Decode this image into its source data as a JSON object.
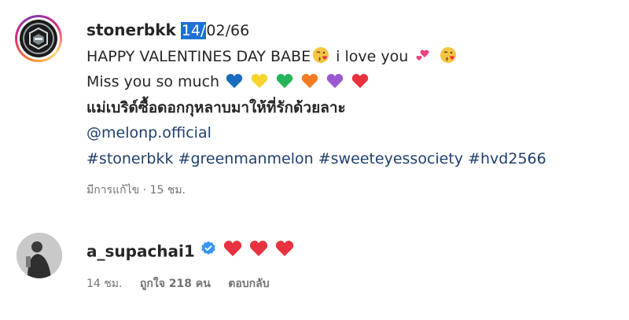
{
  "post": {
    "username": "stonerbkk",
    "date_selected": "14/",
    "date_rest": "02/66",
    "line1": "HAPPY VALENTINES DAY BABE",
    "line1b": "i love you",
    "line2": "Miss you so much",
    "line3": "แม่เบริด์ซื้อดอกกุหลาบมาให้ที่รักด้วยลาะ",
    "mention": "@melonp.official",
    "hashtags": "#stonerbkk #greenmanmelon #sweeteyessociety #hvd2566",
    "edited": "มีการแก้ไข",
    "time": "15 ชม."
  },
  "comment": {
    "username": "a_supachai1",
    "time": "14 ชม.",
    "likes": "ถูกใจ 218 คน",
    "reply": "ตอบกลับ"
  },
  "colors": {
    "link": "#1f3f6f",
    "meta": "#737373",
    "verified": "#3897f0",
    "selection": "#1e6fd9"
  },
  "icons": {
    "post_emojis_line1": [
      "kiss-face-icon",
      "two-hearts-icon",
      "kiss-face-icon"
    ],
    "post_emojis_line2": [
      "blue-heart-icon",
      "yellow-heart-icon",
      "green-heart-icon",
      "orange-heart-icon",
      "purple-heart-icon",
      "red-heart-icon"
    ],
    "comment_emojis": [
      "red-heart-icon",
      "red-heart-icon",
      "red-heart-icon"
    ],
    "verified": "verified-badge-icon"
  }
}
